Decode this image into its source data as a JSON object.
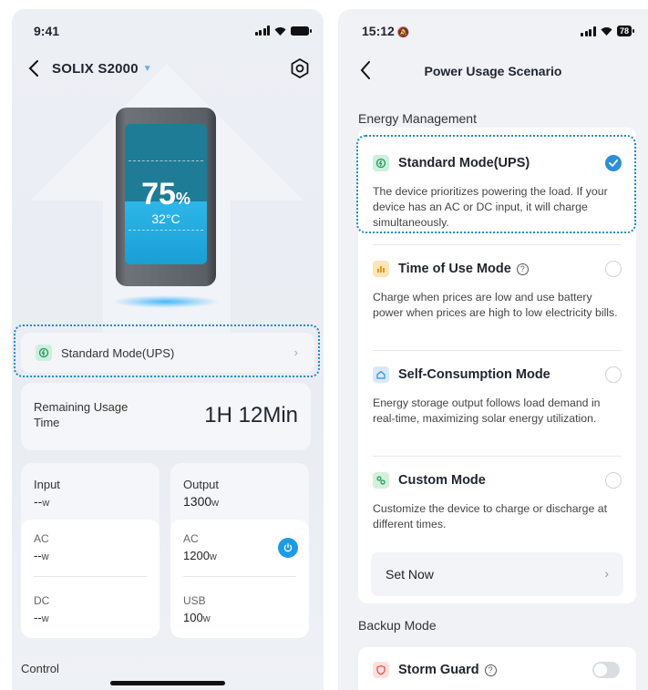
{
  "left": {
    "status": {
      "time": "9:41"
    },
    "nav": {
      "title": "SOLIX S2000"
    },
    "device": {
      "percent": "75",
      "percent_unit": "%",
      "temperature": "32°C"
    },
    "mode": {
      "label": "Standard Mode(UPS)"
    },
    "remaining": {
      "label": "Remaining Usage Time",
      "value": "1H 12Min"
    },
    "input": {
      "title": "Input",
      "value": "--",
      "unit": "w",
      "ac": {
        "label": "AC",
        "value": "--",
        "unit": "w"
      },
      "dc": {
        "label": "DC",
        "value": "--",
        "unit": "w"
      }
    },
    "output": {
      "title": "Output",
      "value": "1300",
      "unit": "w",
      "ac": {
        "label": "AC",
        "value": "1200",
        "unit": "w"
      },
      "usb": {
        "label": "USB",
        "value": "100",
        "unit": "w"
      }
    },
    "control_label": "Control"
  },
  "right": {
    "status": {
      "time": "15:12",
      "battery": "78"
    },
    "nav": {
      "title": "Power Usage Scenario"
    },
    "energy_section": "Energy Management",
    "options": [
      {
        "name": "Standard Mode(UPS)",
        "desc": "The device prioritizes powering the load. If your device has an AC or DC input, it will charge simultaneously.",
        "selected": true
      },
      {
        "name": "Time of Use Mode",
        "desc": "Charge when prices are low and use battery power when prices are high to low electricity bills.",
        "selected": false
      },
      {
        "name": "Self-Consumption Mode",
        "desc": "Energy storage output follows load demand in real-time, maximizing solar energy utilization.",
        "selected": false
      },
      {
        "name": "Custom Mode",
        "desc": "Customize the device to charge or discharge at different times.",
        "selected": false
      }
    ],
    "set_now": "Set Now",
    "backup_section": "Backup Mode",
    "storm_guard": {
      "label": "Storm Guard",
      "enabled": false
    }
  },
  "colors": {
    "accent": "#2d8fd6",
    "highlight_dash": "#1f8ac0",
    "screen_fill": "#2db6e8"
  },
  "icons": [
    "back-chevron-icon",
    "settings-icon",
    "mode-icon",
    "power-icon",
    "help-icon",
    "storm-guard-icon"
  ]
}
